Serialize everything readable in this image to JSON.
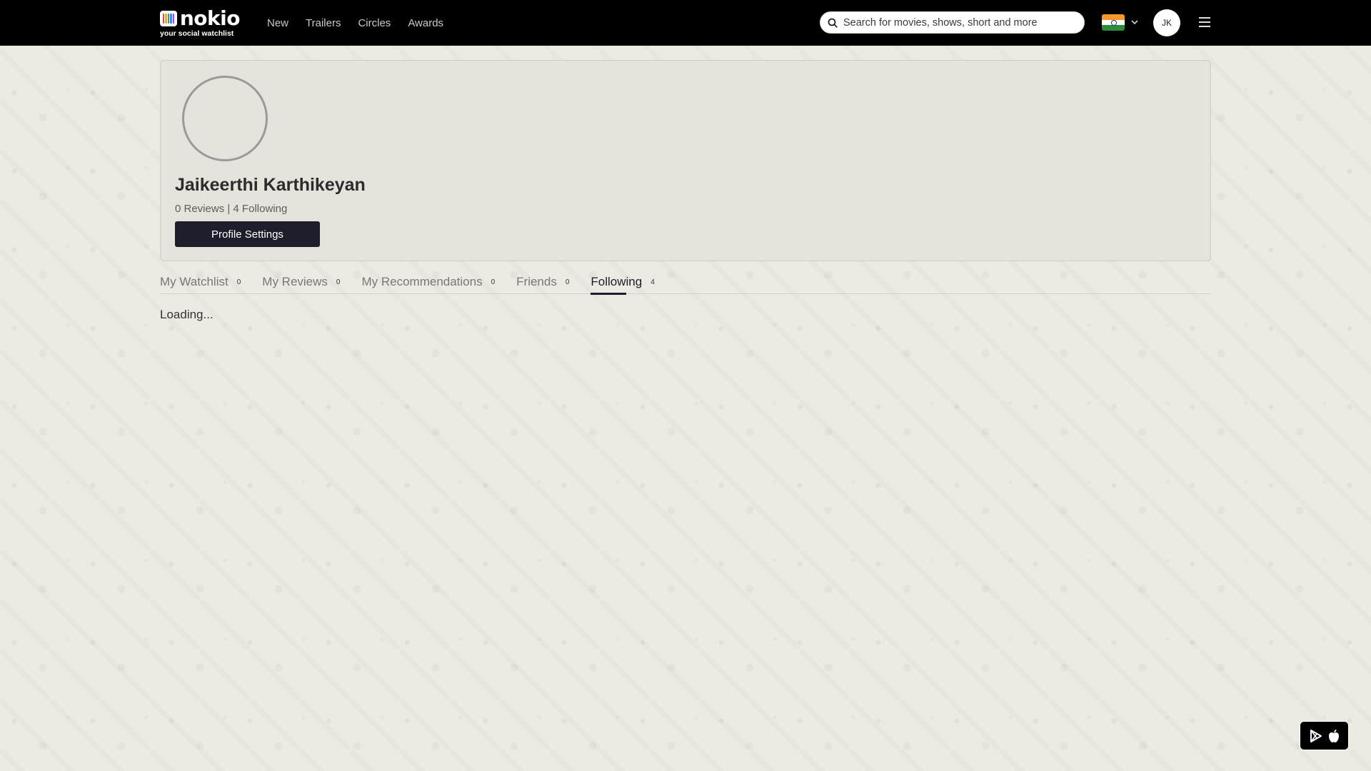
{
  "header": {
    "logo_word": "nokio",
    "logo_tagline": "your social watchlist",
    "nav": [
      {
        "label": "New"
      },
      {
        "label": "Trailers"
      },
      {
        "label": "Circles"
      },
      {
        "label": "Awards"
      }
    ],
    "search_placeholder": "Search for movies, shows, short and more",
    "user_initials": "JK"
  },
  "colors": {
    "header_bg": "#000000",
    "primary": "#1d1d2c",
    "card_bg": "#e6e3dc",
    "page_bg": "#ecebe3"
  },
  "profile": {
    "name": "Jaikeerthi Karthikeyan",
    "stats": "0 Reviews | 4 Following",
    "settings_label": "Profile Settings"
  },
  "tabs": [
    {
      "label": "My Watchlist",
      "count": "0"
    },
    {
      "label": "My Reviews",
      "count": "0"
    },
    {
      "label": "My Recommendations",
      "count": "0"
    },
    {
      "label": "Friends",
      "count": "0"
    },
    {
      "label": "Following",
      "count": "4",
      "active": true
    }
  ],
  "content": {
    "status": "Loading..."
  },
  "icons": {
    "search": "search-icon",
    "flag": "india-flag-icon",
    "chevron": "chevron-down-icon",
    "menu": "hamburger-menu-icon",
    "play_store": "play-store-icon",
    "apple": "apple-icon"
  }
}
